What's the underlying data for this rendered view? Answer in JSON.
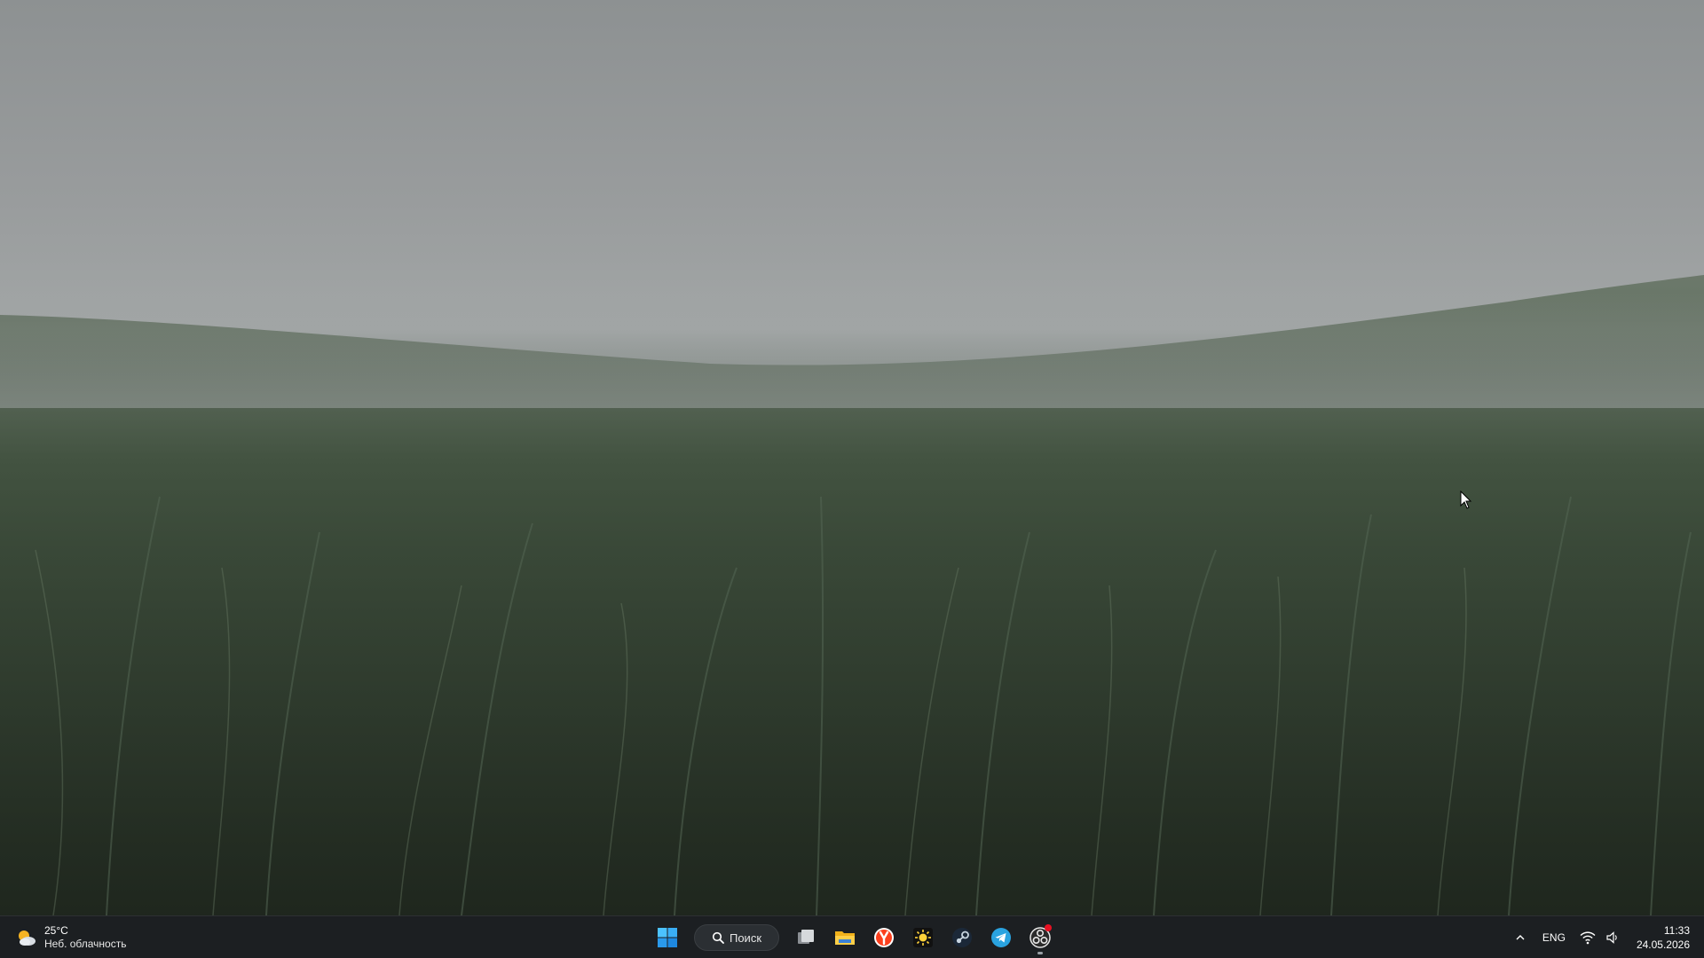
{
  "desktop": {
    "wallpaper_icon": "foggy-grass-field-wallpaper"
  },
  "weather": {
    "temperature": "25°C",
    "condition": "Неб. облачность",
    "icon": "partly-sunny-icon"
  },
  "taskbar": {
    "start_icon": "windows-start-icon",
    "search_label": "Поиск",
    "apps": [
      {
        "name": "task-view",
        "icon": "task-view-icon"
      },
      {
        "name": "file-explorer",
        "icon": "folder-icon"
      },
      {
        "name": "yandex-browser",
        "icon": "yandex-browser-icon"
      },
      {
        "name": "sun-app",
        "icon": "sun-app-icon"
      },
      {
        "name": "steam",
        "icon": "steam-icon"
      },
      {
        "name": "telegram",
        "icon": "telegram-icon"
      },
      {
        "name": "obs-studio",
        "icon": "obs-icon"
      }
    ],
    "accent_blue": "#4cc2ff"
  },
  "tray": {
    "chevron_icon": "chevron-up-icon",
    "language": "ENG",
    "wifi_icon": "wifi-icon",
    "volume_icon": "volume-icon",
    "time": "11:33",
    "date": "24.05.2026"
  }
}
